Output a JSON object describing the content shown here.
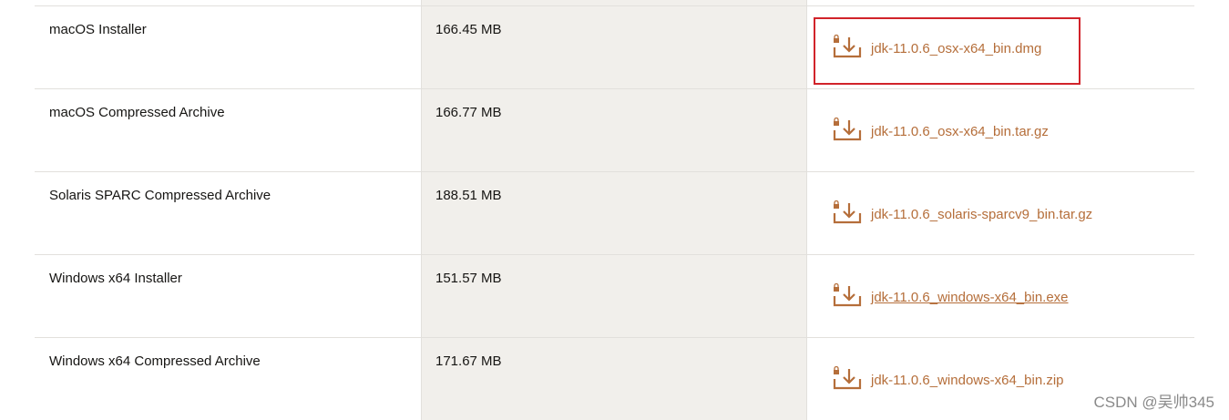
{
  "downloads": [
    {
      "name": "macOS Installer",
      "size": "166.45 MB",
      "file": "jdk-11.0.6_osx-x64_bin.dmg",
      "underlined": false
    },
    {
      "name": "macOS Compressed Archive",
      "size": "166.77 MB",
      "file": "jdk-11.0.6_osx-x64_bin.tar.gz",
      "underlined": false
    },
    {
      "name": "Solaris SPARC Compressed Archive",
      "size": "188.51 MB",
      "file": "jdk-11.0.6_solaris-sparcv9_bin.tar.gz",
      "underlined": false
    },
    {
      "name": "Windows x64 Installer",
      "size": "151.57 MB",
      "file": "jdk-11.0.6_windows-x64_bin.exe",
      "underlined": true
    },
    {
      "name": "Windows x64 Compressed Archive",
      "size": "171.67 MB",
      "file": "jdk-11.0.6_windows-x64_bin.zip",
      "underlined": false
    }
  ],
  "highlighted_row": 0,
  "icon": "download-lock-icon",
  "colors": {
    "link": "#b56e3a",
    "highlight_border": "#d1232a",
    "size_column_bg": "#f1efeb"
  },
  "watermark": "CSDN @吴帅345"
}
